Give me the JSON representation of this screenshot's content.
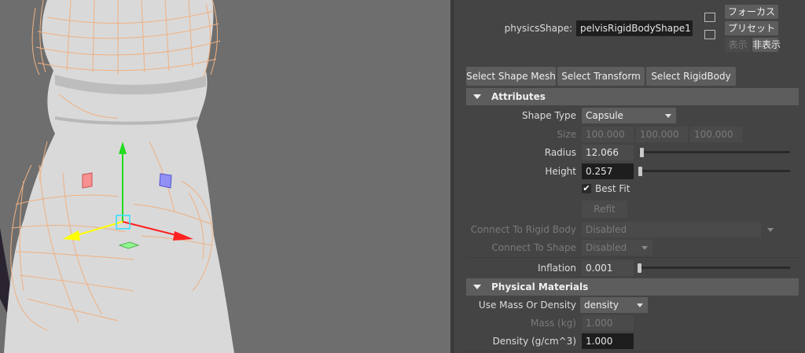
{
  "header": {
    "shape_label": "physicsShape:",
    "shape_value": "pelvisRigidBodyShape1",
    "focus_button": "フォーカス",
    "preset_button": "プリセット",
    "show_button": "表示",
    "hide_button": "非表示"
  },
  "toolbar": {
    "select_shape_mesh": "Select Shape Mesh",
    "select_transform": "Select Transform",
    "select_rigidbody": "Select RigidBody"
  },
  "attributes": {
    "title": "Attributes",
    "shape_type_label": "Shape Type",
    "shape_type_value": "Capsule",
    "size_label": "Size",
    "size_values": [
      "100.000",
      "100.000",
      "100.000"
    ],
    "radius_label": "Radius",
    "radius_value": "12.066",
    "height_label": "Height",
    "height_value": "0.257",
    "best_fit_label": "Best Fit",
    "best_fit_checked": true,
    "refit_button": "Refit",
    "connect_rigid_label": "Connect To Rigid Body",
    "connect_rigid_value": "Disabled",
    "connect_shape_label": "Connect To Shape",
    "connect_shape_value": "Disabled",
    "inflation_label": "Inflation",
    "inflation_value": "0.001"
  },
  "physical_materials": {
    "title": "Physical Materials",
    "use_mass_label": "Use Mass Or Density",
    "use_mass_value": "density",
    "mass_label": "Mass (kg)",
    "mass_value": "1.000",
    "density_label": "Density (g/cm^3)",
    "density_value": "1.000"
  },
  "icons": [
    "checkmark-icon",
    "dropdown-arrow-icon",
    "collapse-triangle-icon",
    "load-input-icon",
    "load-output-icon",
    "translate-manipulator-icon"
  ],
  "colors": {
    "viewport_bg": "#6e6e6e",
    "panel_bg": "#444444",
    "wireframe": "#f0b080",
    "manip_x": "#ff2020",
    "manip_y": "#20dd20",
    "manip_z": "#ffff00"
  }
}
